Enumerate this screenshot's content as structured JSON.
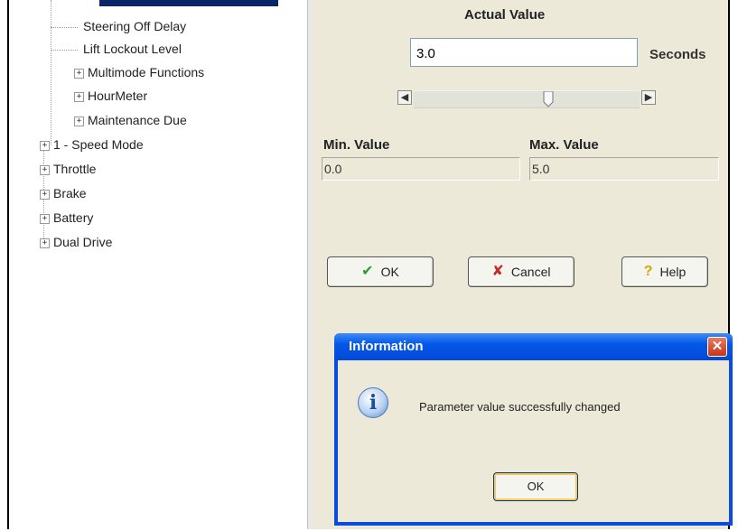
{
  "tree": {
    "items": [
      {
        "label": "Steering Off Delay",
        "expandable": false
      },
      {
        "label": "Lift Lockout Level",
        "expandable": false
      },
      {
        "label": "Multimode Functions",
        "expandable": true
      },
      {
        "label": "HourMeter",
        "expandable": true
      },
      {
        "label": "Maintenance Due",
        "expandable": true
      },
      {
        "label": "1 - Speed Mode",
        "expandable": true
      },
      {
        "label": "Throttle",
        "expandable": true
      },
      {
        "label": "Brake",
        "expandable": true
      },
      {
        "label": "Battery",
        "expandable": true
      },
      {
        "label": "Dual Drive",
        "expandable": true
      }
    ]
  },
  "editor": {
    "actual_label": "Actual Value",
    "actual_value": "3.0",
    "units": "Seconds",
    "slider_fraction": 0.6,
    "min_label": "Min. Value",
    "min_value": "0.0",
    "max_label": "Max. Value",
    "max_value": "5.0",
    "ok_label": "OK",
    "cancel_label": "Cancel",
    "help_label": "Help"
  },
  "dialog": {
    "title": "Information",
    "message": "Parameter value successfully changed",
    "ok_label": "OK"
  },
  "icons": {
    "expand": "plus-box-icon",
    "ok": "check-icon",
    "cancel": "cancel-icon",
    "help": "question-icon",
    "info": "information-icon",
    "close": "close-icon"
  },
  "colors": {
    "dialog_title": "#0557e8",
    "selection": "#0a246a",
    "panel": "#ece9d8"
  }
}
